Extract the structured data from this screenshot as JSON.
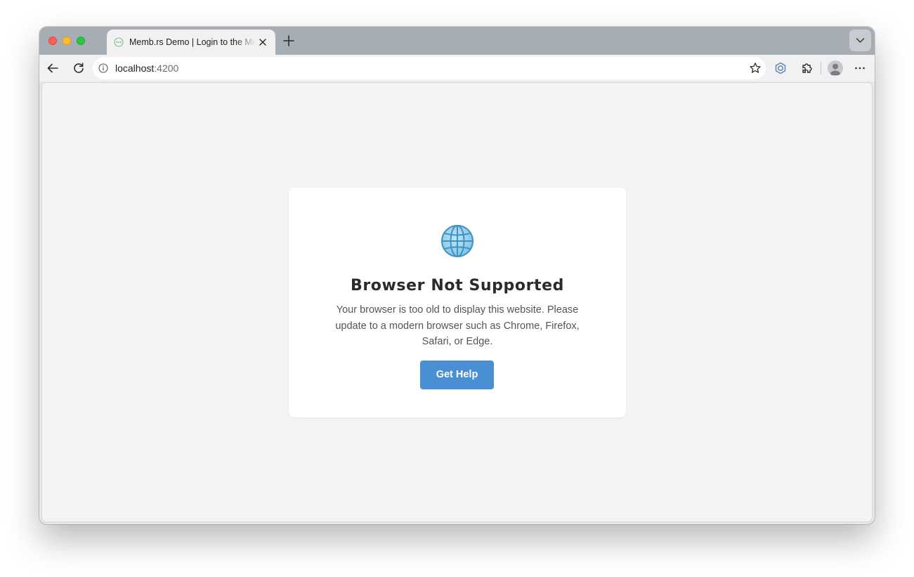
{
  "browser": {
    "tab": {
      "title": "Memb.rs Demo | Login to the Memb.rs Demo",
      "favicon": "membrs-favicon-icon"
    },
    "toolbar": {
      "url_host": "localhost",
      "url_port": ":4200",
      "icons": [
        "back-arrow-icon",
        "reload-icon",
        "info-icon",
        "bookmark-star-icon",
        "extension-icon",
        "puzzle-icon",
        "profile-avatar-icon",
        "more-icon"
      ]
    }
  },
  "page": {
    "icon": "globe-icon",
    "title": "Browser Not Supported",
    "message": "Your browser is too old to display this website. Please update to a modern browser such as Chrome, Firefox, Safari, or Edge.",
    "button_label": "Get Help"
  },
  "colors": {
    "page_background": "#f4f4f4",
    "card_background": "#ffffff",
    "button": "#4a8fd4",
    "title": "#2b2b2b",
    "message": "#555555"
  }
}
